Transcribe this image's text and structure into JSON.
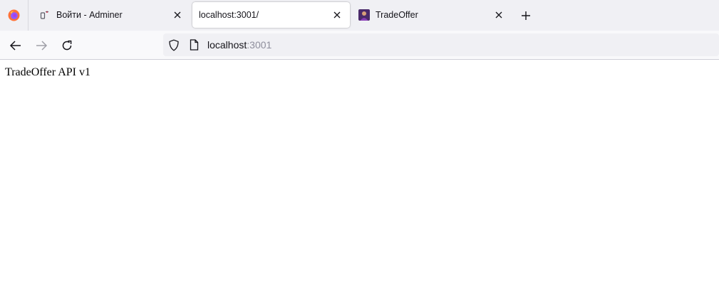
{
  "browser": {
    "tabs": [
      {
        "title": "Войти - Adminer",
        "active": false
      },
      {
        "title": "localhost:3001/",
        "active": true
      },
      {
        "title": "TradeOffer",
        "active": false
      }
    ],
    "urlbar": {
      "host": "localhost",
      "port": ":3001"
    }
  },
  "page": {
    "body_text": "TradeOffer API v1"
  },
  "colors": {
    "tabbar_bg": "#f0f0f4",
    "navbar_bg": "#f9f9fb",
    "firefox_orange": "#ff7139",
    "firefox_purple": "#9059ff"
  }
}
